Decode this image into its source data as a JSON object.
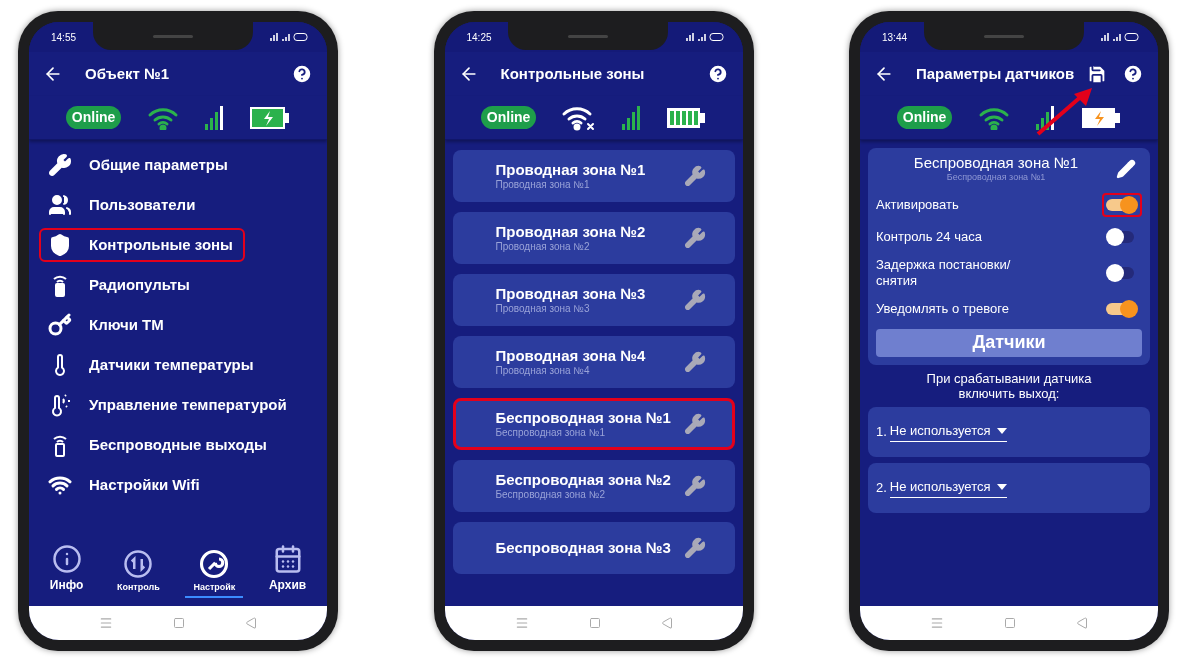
{
  "phones": [
    {
      "kind": "menu",
      "time": "14:55",
      "title": "Объект №1",
      "save_button": false,
      "pointer_arrow": false,
      "online": "Online",
      "wifi": {
        "kind": "connected"
      },
      "battery": {
        "kind": "charging"
      },
      "menu": [
        {
          "label": "Общие параметры",
          "highlighted": false
        },
        {
          "label": "Пользователи",
          "highlighted": false
        },
        {
          "label": "Контрольные зоны",
          "highlighted": true
        },
        {
          "label": "Радиопульты",
          "highlighted": false
        },
        {
          "label": "Ключи ТМ",
          "highlighted": false
        },
        {
          "label": "Датчики температуры",
          "highlighted": false
        },
        {
          "label": "Управление температурой",
          "highlighted": false
        },
        {
          "label": "Беспроводные выходы",
          "highlighted": false
        },
        {
          "label": "Настройки Wifi",
          "highlighted": false
        }
      ],
      "bottom_nav": [
        {
          "label": "Инфо",
          "selected": false
        },
        {
          "label": "Контроль",
          "selected": false
        },
        {
          "label": "Настройк",
          "selected": true
        },
        {
          "label": "Архив",
          "selected": false
        }
      ]
    },
    {
      "kind": "zones",
      "time": "14:25",
      "title": "Контрольные зоны",
      "save_button": false,
      "pointer_arrow": false,
      "online": "Online",
      "wifi": {
        "kind": "no_internet"
      },
      "battery": {
        "kind": "full"
      },
      "zones": [
        {
          "title": "Проводная зона №1",
          "subtitle": "Проводная зона  №1",
          "highlighted": false
        },
        {
          "title": "Проводная зона №2",
          "subtitle": "Проводная зона  №2",
          "highlighted": false
        },
        {
          "title": "Проводная зона №3",
          "subtitle": "Проводная зона  №3",
          "highlighted": false
        },
        {
          "title": "Проводная зона №4",
          "subtitle": "Проводная зона  №4",
          "highlighted": false
        },
        {
          "title": "Беспроводная зона №1",
          "subtitle": "Беспроводная зона  №1",
          "highlighted": true
        },
        {
          "title": "Беспроводная зона №2",
          "subtitle": "Беспроводная зона  №2",
          "highlighted": false
        },
        {
          "title": "Беспроводная зона №3",
          "highlighted": false
        }
      ]
    },
    {
      "kind": "sensor",
      "time": "13:44",
      "title": "Параметры датчиков",
      "save_button": true,
      "pointer_arrow": true,
      "online": "Online",
      "wifi": {
        "kind": "connected"
      },
      "battery": {
        "kind": "charging_low"
      },
      "zone": {
        "title": "Беспроводная зона №1",
        "subtitle": "Беспроводная зона №1"
      },
      "toggles": [
        {
          "label": "Активировать",
          "on": true,
          "highlighted": true
        },
        {
          "label": "Контроль 24 часа",
          "on": false,
          "highlighted": false
        },
        {
          "label": "Задержка постановки/снятия",
          "on": false,
          "highlighted": false
        },
        {
          "label": "Уведомлять о тревоге",
          "on": true,
          "highlighted": false
        }
      ],
      "sensors_button": "Датчики",
      "outputs_caption": "При срабатывании датчика включить выход:",
      "outputs": [
        {
          "number": "1.",
          "value": "Не используется"
        },
        {
          "number": "2.",
          "value": "Не используется"
        }
      ]
    }
  ]
}
